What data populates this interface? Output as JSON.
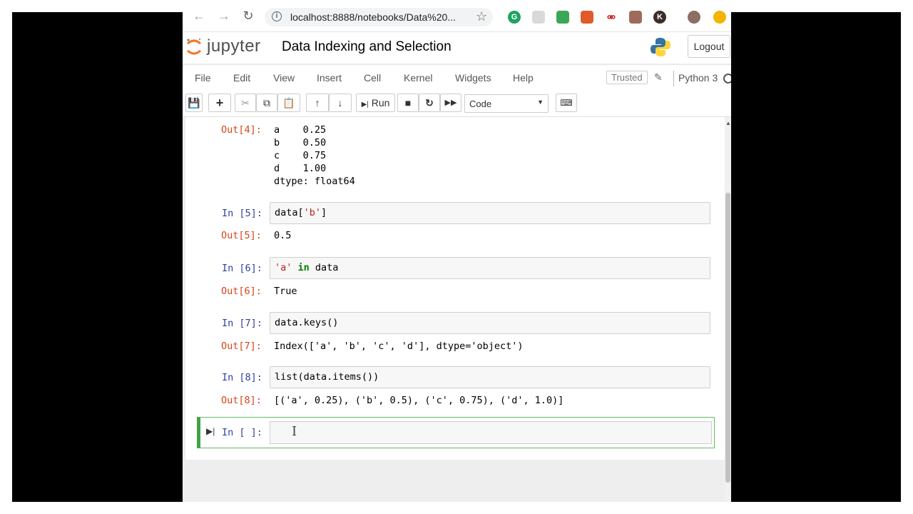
{
  "browser": {
    "url": "localhost:8888/notebooks/Data%20...",
    "back_icon": "back-arrow-icon",
    "forward_icon": "forward-arrow-icon",
    "reload_icon": "reload-icon",
    "bookmark_icon": "star-icon"
  },
  "header": {
    "logo_text": "jupyter",
    "notebook_title": "Data Indexing and Selection",
    "logout_label": "Logout"
  },
  "menubar": {
    "items": [
      "File",
      "Edit",
      "View",
      "Insert",
      "Cell",
      "Kernel",
      "Widgets",
      "Help"
    ],
    "trusted_label": "Trusted",
    "kernel_name": "Python 3"
  },
  "toolbar": {
    "run_label": "Run",
    "cell_type": "Code"
  },
  "cells": [
    {
      "out_prompt": "Out[4]:",
      "output": "a    0.25\nb    0.50\nc    0.75\nd    1.00\ndtype: float64"
    },
    {
      "in_prompt": "In [5]:",
      "code_prefix": "data[",
      "code_string": "'b'",
      "code_suffix": "]",
      "out_prompt": "Out[5]:",
      "output": "0.5"
    },
    {
      "in_prompt": "In [6]:",
      "code_string": "'a'",
      "code_keyword": " in",
      "code_suffix": " data",
      "out_prompt": "Out[6]:",
      "output": "True"
    },
    {
      "in_prompt": "In [7]:",
      "code": "data.keys()",
      "out_prompt": "Out[7]:",
      "output": "Index(['a', 'b', 'c', 'd'], dtype='object')"
    },
    {
      "in_prompt": "In [8]:",
      "code": "list(data.items())",
      "out_prompt": "Out[8]:",
      "output": "[('a', 0.25), ('b', 0.5), ('c', 0.75), ('d', 1.0)]"
    },
    {
      "in_prompt": "In [ ]:",
      "code": ""
    }
  ],
  "colors": {
    "in_prompt": "#303f9f",
    "out_prompt": "#d84315",
    "active_cell_border": "#42a047",
    "string": "#ba2121",
    "keyword": "#008000"
  }
}
